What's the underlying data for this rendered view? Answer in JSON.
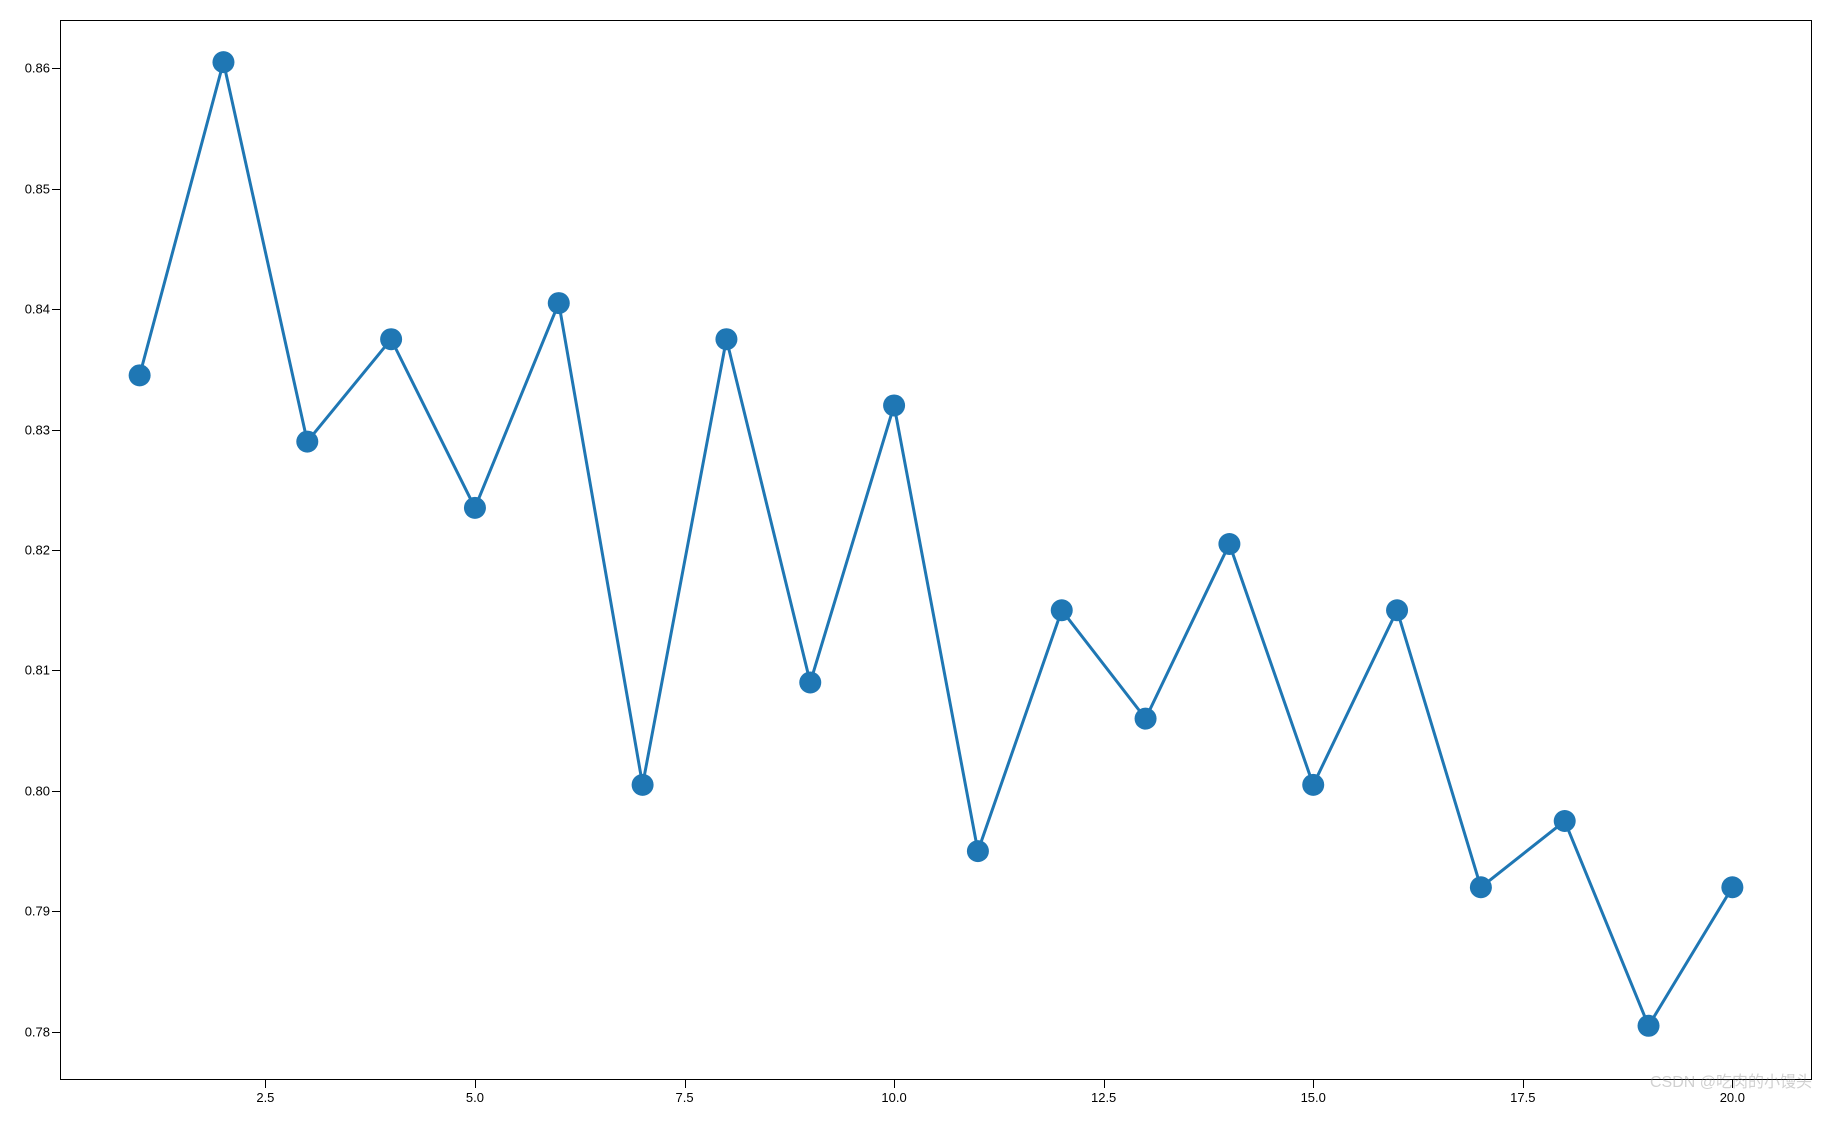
{
  "chart_data": {
    "type": "line",
    "x": [
      1,
      2,
      3,
      4,
      5,
      6,
      7,
      8,
      9,
      10,
      11,
      12,
      13,
      14,
      15,
      16,
      17,
      18,
      19,
      20
    ],
    "y": [
      0.8345,
      0.8605,
      0.829,
      0.8375,
      0.8235,
      0.8405,
      0.8005,
      0.8375,
      0.809,
      0.832,
      0.795,
      0.815,
      0.806,
      0.8205,
      0.8005,
      0.815,
      0.792,
      0.7975,
      0.7805,
      0.792
    ],
    "title": "",
    "xlabel": "",
    "ylabel": "",
    "xlim": [
      0.05,
      20.95
    ],
    "ylim": [
      0.776,
      0.864
    ],
    "x_ticks": [
      2.5,
      5.0,
      7.5,
      10.0,
      12.5,
      15.0,
      17.5,
      20.0
    ],
    "x_tick_labels": [
      "2.5",
      "5.0",
      "7.5",
      "10.0",
      "12.5",
      "15.0",
      "17.5",
      "20.0"
    ],
    "y_ticks": [
      0.78,
      0.79,
      0.8,
      0.81,
      0.82,
      0.83,
      0.84,
      0.85,
      0.86
    ],
    "y_tick_labels": [
      "0.78",
      "0.79",
      "0.80",
      "0.81",
      "0.82",
      "0.83",
      "0.84",
      "0.85",
      "0.86"
    ],
    "line_color": "#1f77b4",
    "marker_size": 11
  },
  "watermark": "CSDN @吃肉的小馒头"
}
